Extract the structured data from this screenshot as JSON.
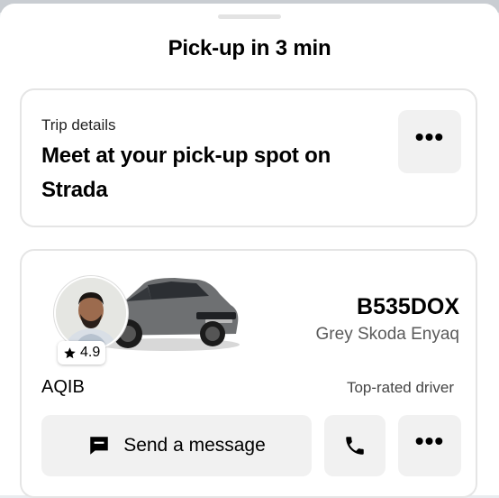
{
  "header": {
    "title": "Pick-up in 3 min"
  },
  "trip": {
    "label": "Trip details",
    "main": "Meet at your pick-up spot on Strada",
    "more": "•••"
  },
  "driver": {
    "rating_icon": "star-icon",
    "rating": "4.9",
    "plate": "B535DOX",
    "car_model": "Grey Skoda Enyaq",
    "name": "AQIB",
    "badge": "Top-rated driver"
  },
  "actions": {
    "message_icon": "chat-bubble-icon",
    "message_label": "Send a message",
    "call_icon": "phone-icon",
    "more": "•••"
  }
}
